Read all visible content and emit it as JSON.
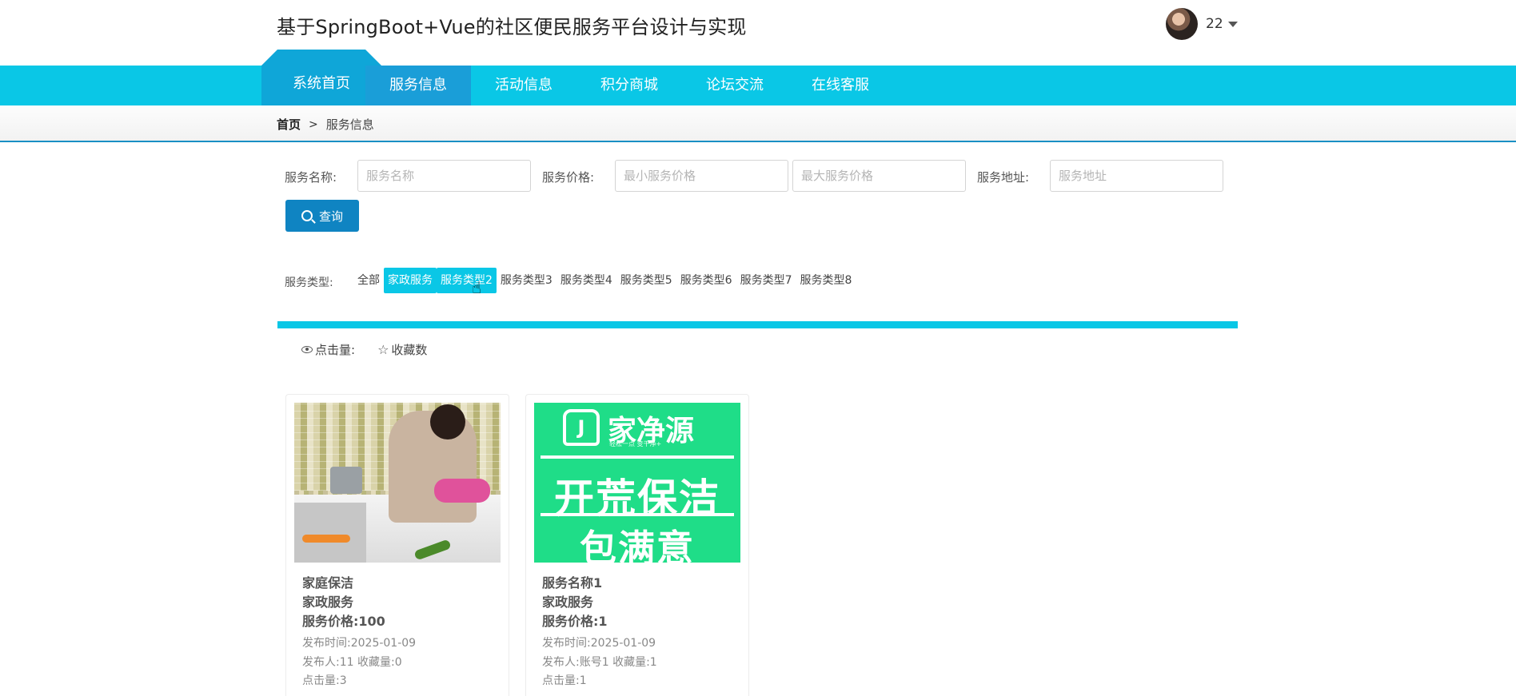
{
  "header": {
    "site_title": "基于SpringBoot+Vue的社区便民服务平台设计与实现",
    "user_name": "22"
  },
  "nav": {
    "home": "系统首页",
    "items": [
      "服务信息",
      "活动信息",
      "积分商城",
      "论坛交流",
      "在线客服"
    ],
    "active_index": 0
  },
  "breadcrumb": {
    "home": "首页",
    "separator": ">",
    "current": "服务信息"
  },
  "search": {
    "name_label": "服务名称:",
    "name_placeholder": "服务名称",
    "price_label": "服务价格:",
    "min_price_placeholder": "最小服务价格",
    "max_price_placeholder": "最大服务价格",
    "address_label": "服务地址:",
    "address_placeholder": "服务地址",
    "button_label": "查询"
  },
  "types": {
    "label": "服务类型:",
    "items": [
      "全部",
      "家政服务",
      "服务类型2",
      "服务类型3",
      "服务类型4",
      "服务类型5",
      "服务类型6",
      "服务类型7",
      "服务类型8"
    ],
    "highlighted": [
      "家政服务",
      "服务类型2"
    ]
  },
  "sort": {
    "clicks_label": "点击量:",
    "favorites_label": "收藏数"
  },
  "cards": [
    {
      "title": "家庭保洁",
      "category": "家政服务",
      "price": "服务价格:100",
      "publish_time": "发布时间:2025-01-09",
      "publisher_and_favs": "发布人:11   收藏量:0",
      "clicks": "点击量:3",
      "image": "kitchen-cleaning-photo"
    },
    {
      "title": "服务名称1",
      "category": "家政服务",
      "price": "服务价格:1",
      "publish_time": "发布时间:2025-01-09",
      "publisher_and_favs": "发布人:账号1   收藏量:1",
      "clicks": "点击量:1",
      "image": "cleaning-poster",
      "poster": {
        "brand": "家净源",
        "slogan": "轻松一点 变干净+",
        "line1": "开荒保洁",
        "line2": "包满意"
      }
    }
  ],
  "colors": {
    "nav_bg": "#0ac7e6",
    "nav_active": "#1a9ed8",
    "home_tab": "#0fa6d8",
    "search_button": "#0f84c2",
    "poster_green": "#1fdd88"
  },
  "icons": {
    "search": "search-icon",
    "eye": "eye-icon",
    "star": "star-outline-icon",
    "caret": "caret-down-icon",
    "cursor": "hand-pointer-cursor"
  }
}
